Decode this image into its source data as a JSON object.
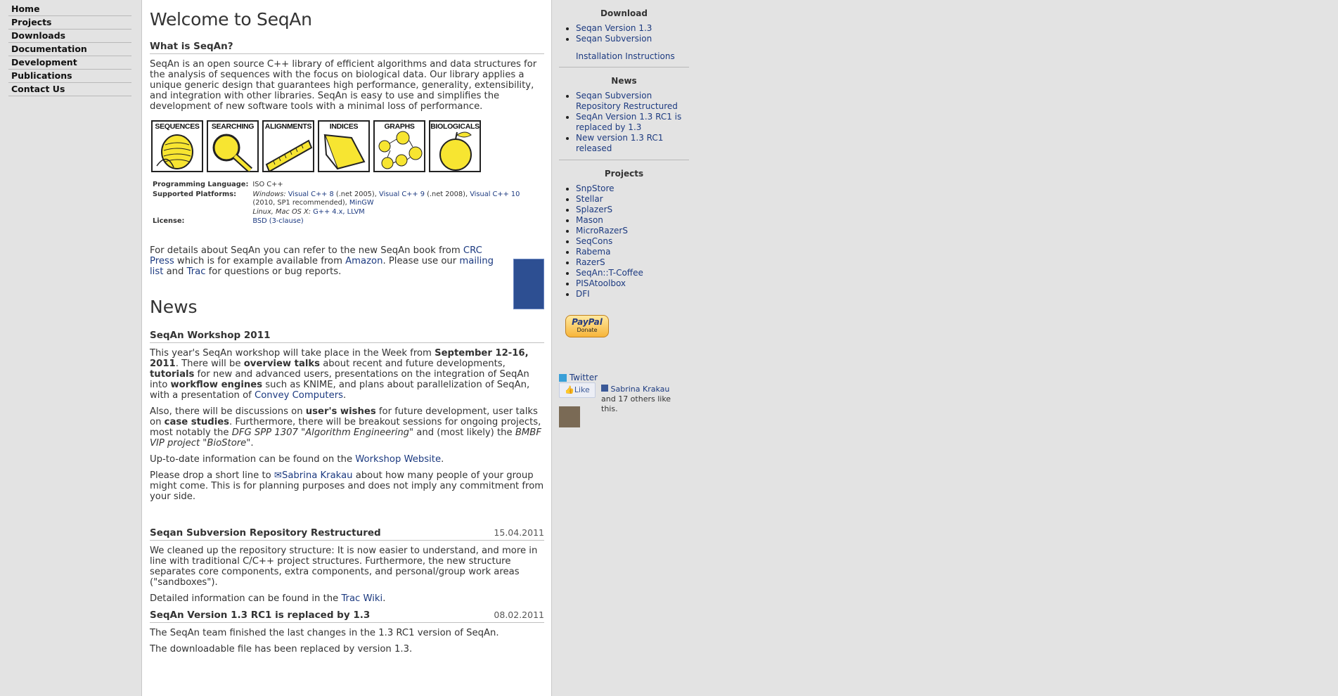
{
  "nav": [
    "Home",
    "Projects",
    "Downloads",
    "Documentation",
    "Development",
    "Publications",
    "Contact Us"
  ],
  "main": {
    "title": "Welcome to SeqAn",
    "what_heading": "What is SeqAn?",
    "intro": "SeqAn is an open source C++ library of efficient algorithms and data structures for the analysis of sequences with the focus on biological data. Our library applies a unique generic design that guarantees high performance, generality, extensibility, and integration with other libraries. SeqAn is easy to use and simplifies the development of new software tools with a minimal loss of performance.",
    "icons": [
      "SEQUENCES",
      "SEARCHING",
      "ALIGNMENTS",
      "INDICES",
      "GRAPHS",
      "BIOLOGICALS"
    ],
    "info": {
      "lang_k": "Programming Language:",
      "lang_v": "ISO C++",
      "plat_k": "Supported Platforms:",
      "win": "Windows:",
      "vc8": "Visual C++ 8",
      "vc8n": "(.net 2005),",
      "vc9": "Visual C++ 9",
      "vc9n": "(.net 2008),",
      "vc10": "Visual C++ 10",
      "vc10n": "(2010, SP1 recommended),",
      "mingw": "MinGW",
      "unix": "Linux, Mac OS X:",
      "gcc": "G++ 4.x,",
      "llvm": "LLVM",
      "lic_k": "License:",
      "lic_v": "BSD (3-clause)"
    },
    "book": {
      "t1": "For details about SeqAn you can refer to the new SeqAn book from ",
      "crc": "CRC Press",
      "t2": " which is for example available from ",
      "amazon": "Amazon",
      "t3": ". Please use our ",
      "mailing": "mailing list",
      "t4": " and ",
      "trac": "Trac",
      "t5": " for questions or bug reports."
    },
    "news_heading": "News",
    "workshop": {
      "title": "SeqAn Workshop 2011",
      "p1a": "This year's SeqAn workshop will take place in the Week from ",
      "p1b": "September 12-16, 2011",
      "p1c": ". There will be ",
      "p1d": "overview talks",
      "p1e": " about recent and future developments, ",
      "p1f": "tutorials",
      "p1g": " for new and advanced users, presentations on the integration of SeqAn into ",
      "p1h": "workflow engines",
      "p1i": " such as KNIME, and plans about parallelization of SeqAn, with a presentation of ",
      "p1j": "Convey Computers",
      "p1k": ".",
      "p2a": "Also, there will be discussions on ",
      "p2b": "user's wishes",
      "p2c": " for future development, user talks on ",
      "p2d": "case studies",
      "p2e": ". Furthermore, there will be breakout sessions for ongoing projects, most notably the ",
      "p2f": "DFG SPP 1307 \"Algorithm Engineering\"",
      "p2g": " and (most likely) the ",
      "p2h": "BMBF VIP project \"BioStore\"",
      "p2i": ".",
      "p3a": "Up-to-date information can be found on the ",
      "p3b": "Workshop Website",
      "p3c": ".",
      "p4a": "Please drop a short line to ",
      "p4b": "Sabrina Krakau",
      "p4c": " about how many people of your group might come. This is for planning purposes and does not imply any commitment from your side."
    },
    "svn": {
      "title": "Seqan Subversion Repository Restructured",
      "date": "15.04.2011",
      "p1": "We cleaned up the repository structure: It is now easier to understand, and more in line with traditional C/C++ project structures. Furthermore, the new structure separates core components, extra components, and personal/group work areas (\"sandboxes\").",
      "p2a": "Detailed information can be found in the ",
      "p2b": "Trac Wiki",
      "p2c": "."
    },
    "rc": {
      "title": "SeqAn Version 1.3 RC1 is replaced by 1.3",
      "date": "08.02.2011",
      "p1": "The SeqAn team finished the last changes in the 1.3 RC1 version of SeqAn.",
      "p2": "The downloadable file has been replaced by version 1.3."
    }
  },
  "side": {
    "download": "Download",
    "dl": [
      "Seqan Version 1.3",
      "Seqan Subversion"
    ],
    "install": "Installation Instructions",
    "news": "News",
    "newsitems": [
      "Seqan Subversion Repository Restructured",
      "SeqAn Version 1.3 RC1 is replaced by 1.3",
      "New version 1.3 RC1 released"
    ],
    "projects": "Projects",
    "projectitems": [
      "SnpStore",
      "Stellar",
      "SplazerS",
      "Mason",
      "MicroRazerS",
      "SeqCons",
      "Rabema",
      "RazerS",
      "SeqAn::T-Coffee",
      "PISAtoolbox",
      "DFI"
    ],
    "paypal": "PayPal",
    "donate": "Donate",
    "twitter": "Twitter",
    "like": "Like",
    "fbname": "Sabrina Krakau",
    "fbrest": " and 17 others like this."
  }
}
